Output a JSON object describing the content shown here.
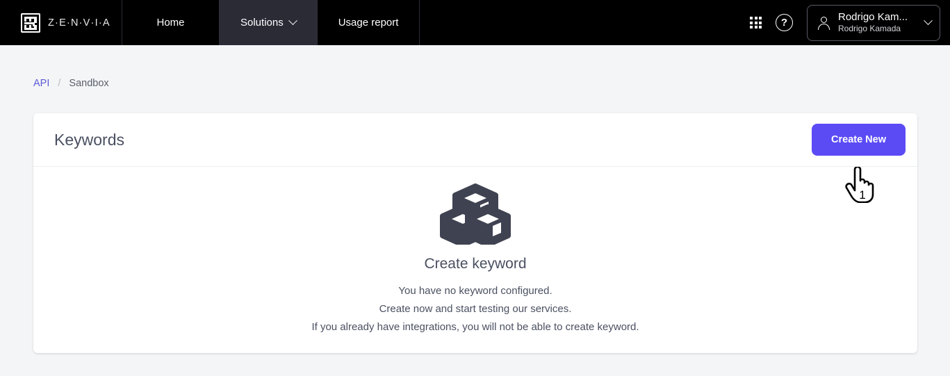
{
  "navbar": {
    "brand": {
      "logo_icon": "zenvia-logo-icon",
      "wordmark": "Z·E·N·V·I·A"
    },
    "items": [
      {
        "label": "Home",
        "active": false,
        "has_caret": false
      },
      {
        "label": "Solutions",
        "active": true,
        "has_caret": true
      },
      {
        "label": "Usage report",
        "active": false,
        "has_caret": false
      }
    ],
    "actions": {
      "apps_grid_icon": "apps-grid-icon",
      "help_icon": "question-mark-circle-icon",
      "help_glyph": "?"
    },
    "profile": {
      "avatar_icon": "user-avatar-icon",
      "name": "Rodrigo Kam...",
      "full_name": "Rodrigo Kamada",
      "caret_icon": "chevron-down-icon"
    }
  },
  "breadcrumb": {
    "link": "API",
    "separator": "/",
    "current": "Sandbox"
  },
  "card": {
    "title": "Keywords",
    "create_button": "Create New"
  },
  "empty_state": {
    "illustration_icon": "three-cubes-icon",
    "title": "Create keyword",
    "lines": [
      "You have no keyword configured.",
      "Create now and start testing our services.",
      "If you already have integrations, you will not be able to create keyword."
    ]
  },
  "cursor": {
    "icon": "pointing-hand-cursor",
    "badge": "1"
  },
  "colors": {
    "navbar_bg": "#000000",
    "nav_active_bg": "#2b2b36",
    "page_bg": "#f4f5f7",
    "card_bg": "#ffffff",
    "primary": "#5b4bf5",
    "link": "#5b5bd6",
    "text": "#4a5061",
    "illustration": "#3f4251"
  }
}
